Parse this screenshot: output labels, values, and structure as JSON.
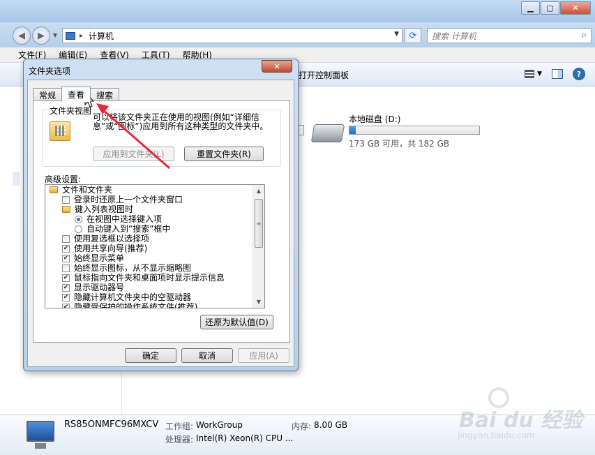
{
  "explorer": {
    "address_path": "计算机",
    "search_placeholder": "搜索 计算机",
    "menu": [
      "文件(F)",
      "编辑(E)",
      "查看(V)",
      "工具(T)",
      "帮助(H)"
    ],
    "toolbar_partial_label": "打开控制面板",
    "drive": {
      "name": "本地磁盘 (D:)",
      "free_text": "173 GB 可用，共 182 GB",
      "used_fraction": 0.05
    },
    "status": {
      "computer_name": "RS85ONMFC96MXCV",
      "workgroup_label": "工作组:",
      "workgroup_value": "WorkGroup",
      "memory_label": "内存:",
      "memory_value": "8.00 GB",
      "cpu_label": "处理器:",
      "cpu_value": "Intel(R) Xeon(R) CPU ..."
    }
  },
  "dialog": {
    "title": "文件夹选项",
    "tabs": [
      "常规",
      "查看",
      "搜索"
    ],
    "active_tab": 1,
    "group_label": "文件夹视图",
    "description": "可以将该文件夹正在使用的视图(例如“详细信息”或“图标”)应用到所有这种类型的文件夹中。",
    "apply_to_folders": "应用到文件夹(L)",
    "reset_folders": "重置文件夹(R)",
    "advanced_label": "高级设置:",
    "tree": [
      {
        "type": "folder",
        "indent": 0,
        "label": "文件和文件夹"
      },
      {
        "type": "checkbox",
        "indent": 1,
        "checked": false,
        "label": "登录时还原上一个文件夹窗口"
      },
      {
        "type": "folder",
        "indent": 1,
        "label": "键入列表视图时"
      },
      {
        "type": "radio",
        "indent": 2,
        "checked": true,
        "label": "在视图中选择键入项"
      },
      {
        "type": "radio",
        "indent": 2,
        "checked": false,
        "label": "自动键入到“搜索”框中"
      },
      {
        "type": "checkbox",
        "indent": 1,
        "checked": false,
        "label": "使用复选框以选择项"
      },
      {
        "type": "checkbox",
        "indent": 1,
        "checked": true,
        "label": "使用共享向导(推荐)"
      },
      {
        "type": "checkbox",
        "indent": 1,
        "checked": true,
        "label": "始终显示菜单"
      },
      {
        "type": "checkbox",
        "indent": 1,
        "checked": false,
        "label": "始终显示图标，从不显示缩略图"
      },
      {
        "type": "checkbox",
        "indent": 1,
        "checked": true,
        "label": "鼠标指向文件夹和桌面项时显示提示信息"
      },
      {
        "type": "checkbox",
        "indent": 1,
        "checked": true,
        "label": "显示驱动器号"
      },
      {
        "type": "checkbox",
        "indent": 1,
        "checked": true,
        "label": "隐藏计算机文件夹中的空驱动器"
      },
      {
        "type": "checkbox",
        "indent": 1,
        "checked": true,
        "label": "隐藏受保护的操作系统文件(推荐)"
      }
    ],
    "restore_defaults": "还原为默认值(D)",
    "ok": "确定",
    "cancel": "取消",
    "apply": "应用(A)"
  },
  "watermark": {
    "brand": "Bai du 经验",
    "site": "jingyan.baidu.com"
  },
  "colors": {
    "annotation_arrow": "#e8283a",
    "progress_fill": "#2a80d6"
  },
  "icons": {
    "check": "✔",
    "refresh": "⟳",
    "search": "⌕"
  }
}
